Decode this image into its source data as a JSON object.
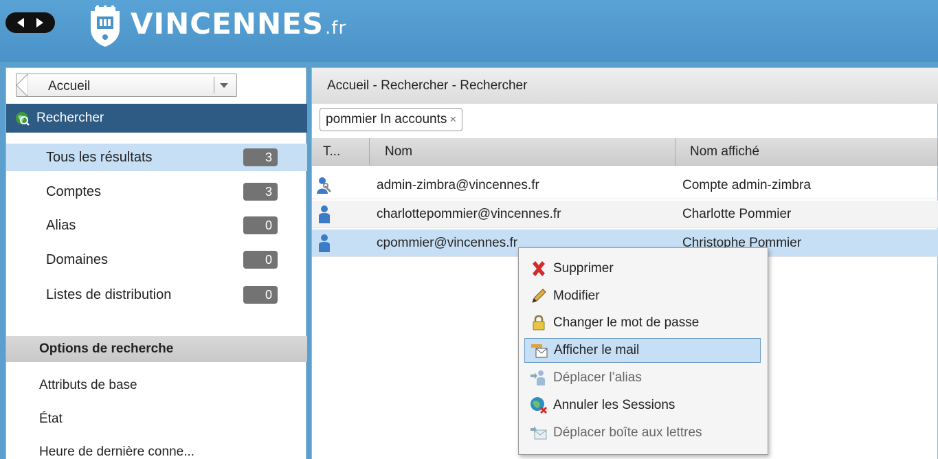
{
  "header": {
    "logo_text": "VINCENNES",
    "logo_suffix": ".fr"
  },
  "sidebar": {
    "breadcrumb": "Accueil",
    "section_title": "Rechercher",
    "results": [
      {
        "label": "Tous les résultats",
        "count": "3"
      },
      {
        "label": "Comptes",
        "count": "3"
      },
      {
        "label": "Alias",
        "count": "0"
      },
      {
        "label": "Domaines",
        "count": "0"
      },
      {
        "label": "Listes de distribution",
        "count": "0"
      }
    ],
    "options_title": "Options de recherche",
    "options": [
      {
        "label": "Attributs de base"
      },
      {
        "label": "État"
      },
      {
        "label": "Heure de dernière conne..."
      }
    ]
  },
  "main": {
    "page_title": "Accueil - Rechercher - Rechercher",
    "search_chip": "pommier In accounts",
    "search_chip_close": "×",
    "columns": [
      "T...",
      "Nom",
      "Nom affiché"
    ],
    "rows": [
      {
        "type": "admin-account-icon",
        "name": "admin-zimbra@vincennes.fr",
        "display": "Compte admin-zimbra"
      },
      {
        "type": "user-account-icon",
        "name": "charlottepommier@vincennes.fr",
        "display": "Charlotte Pommier"
      },
      {
        "type": "user-account-icon",
        "name": "cpommier@vincennes.fr",
        "display": "Christophe Pommier"
      }
    ]
  },
  "context_menu": {
    "items": [
      {
        "label": "Supprimer",
        "icon": "red-x-icon",
        "enabled": true
      },
      {
        "label": "Modifier",
        "icon": "pencil-icon",
        "enabled": true
      },
      {
        "label": "Changer le mot de passe",
        "icon": "lock-icon",
        "enabled": true
      },
      {
        "label": "Afficher le mail",
        "icon": "mail-view-icon",
        "enabled": true
      },
      {
        "label": "Déplacer l’alias",
        "icon": "move-alias-icon",
        "enabled": false
      },
      {
        "label": "Annuler les Sessions",
        "icon": "cancel-sessions-icon",
        "enabled": true
      },
      {
        "label": "Déplacer boîte aux lettres",
        "icon": "move-mailbox-icon",
        "enabled": false
      }
    ]
  },
  "colors": {
    "header_blue": "#5aa3d6",
    "selected_row": "#c7dff5",
    "section_header": "#2d5b84",
    "badge": "#737373"
  }
}
